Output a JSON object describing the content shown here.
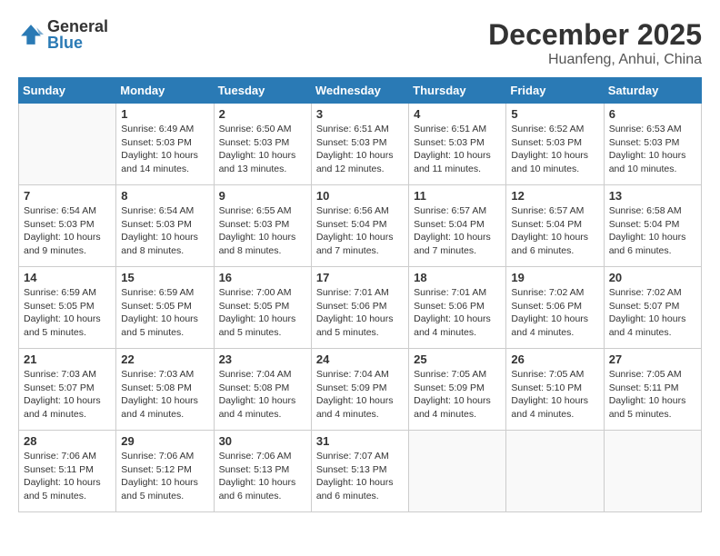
{
  "logo": {
    "general": "General",
    "blue": "Blue"
  },
  "title": "December 2025",
  "location": "Huanfeng, Anhui, China",
  "weekdays": [
    "Sunday",
    "Monday",
    "Tuesday",
    "Wednesday",
    "Thursday",
    "Friday",
    "Saturday"
  ],
  "weeks": [
    [
      {
        "day": "",
        "info": ""
      },
      {
        "day": "1",
        "info": "Sunrise: 6:49 AM\nSunset: 5:03 PM\nDaylight: 10 hours\nand 14 minutes."
      },
      {
        "day": "2",
        "info": "Sunrise: 6:50 AM\nSunset: 5:03 PM\nDaylight: 10 hours\nand 13 minutes."
      },
      {
        "day": "3",
        "info": "Sunrise: 6:51 AM\nSunset: 5:03 PM\nDaylight: 10 hours\nand 12 minutes."
      },
      {
        "day": "4",
        "info": "Sunrise: 6:51 AM\nSunset: 5:03 PM\nDaylight: 10 hours\nand 11 minutes."
      },
      {
        "day": "5",
        "info": "Sunrise: 6:52 AM\nSunset: 5:03 PM\nDaylight: 10 hours\nand 10 minutes."
      },
      {
        "day": "6",
        "info": "Sunrise: 6:53 AM\nSunset: 5:03 PM\nDaylight: 10 hours\nand 10 minutes."
      }
    ],
    [
      {
        "day": "7",
        "info": "Sunrise: 6:54 AM\nSunset: 5:03 PM\nDaylight: 10 hours\nand 9 minutes."
      },
      {
        "day": "8",
        "info": "Sunrise: 6:54 AM\nSunset: 5:03 PM\nDaylight: 10 hours\nand 8 minutes."
      },
      {
        "day": "9",
        "info": "Sunrise: 6:55 AM\nSunset: 5:03 PM\nDaylight: 10 hours\nand 8 minutes."
      },
      {
        "day": "10",
        "info": "Sunrise: 6:56 AM\nSunset: 5:04 PM\nDaylight: 10 hours\nand 7 minutes."
      },
      {
        "day": "11",
        "info": "Sunrise: 6:57 AM\nSunset: 5:04 PM\nDaylight: 10 hours\nand 7 minutes."
      },
      {
        "day": "12",
        "info": "Sunrise: 6:57 AM\nSunset: 5:04 PM\nDaylight: 10 hours\nand 6 minutes."
      },
      {
        "day": "13",
        "info": "Sunrise: 6:58 AM\nSunset: 5:04 PM\nDaylight: 10 hours\nand 6 minutes."
      }
    ],
    [
      {
        "day": "14",
        "info": "Sunrise: 6:59 AM\nSunset: 5:05 PM\nDaylight: 10 hours\nand 5 minutes."
      },
      {
        "day": "15",
        "info": "Sunrise: 6:59 AM\nSunset: 5:05 PM\nDaylight: 10 hours\nand 5 minutes."
      },
      {
        "day": "16",
        "info": "Sunrise: 7:00 AM\nSunset: 5:05 PM\nDaylight: 10 hours\nand 5 minutes."
      },
      {
        "day": "17",
        "info": "Sunrise: 7:01 AM\nSunset: 5:06 PM\nDaylight: 10 hours\nand 5 minutes."
      },
      {
        "day": "18",
        "info": "Sunrise: 7:01 AM\nSunset: 5:06 PM\nDaylight: 10 hours\nand 4 minutes."
      },
      {
        "day": "19",
        "info": "Sunrise: 7:02 AM\nSunset: 5:06 PM\nDaylight: 10 hours\nand 4 minutes."
      },
      {
        "day": "20",
        "info": "Sunrise: 7:02 AM\nSunset: 5:07 PM\nDaylight: 10 hours\nand 4 minutes."
      }
    ],
    [
      {
        "day": "21",
        "info": "Sunrise: 7:03 AM\nSunset: 5:07 PM\nDaylight: 10 hours\nand 4 minutes."
      },
      {
        "day": "22",
        "info": "Sunrise: 7:03 AM\nSunset: 5:08 PM\nDaylight: 10 hours\nand 4 minutes."
      },
      {
        "day": "23",
        "info": "Sunrise: 7:04 AM\nSunset: 5:08 PM\nDaylight: 10 hours\nand 4 minutes."
      },
      {
        "day": "24",
        "info": "Sunrise: 7:04 AM\nSunset: 5:09 PM\nDaylight: 10 hours\nand 4 minutes."
      },
      {
        "day": "25",
        "info": "Sunrise: 7:05 AM\nSunset: 5:09 PM\nDaylight: 10 hours\nand 4 minutes."
      },
      {
        "day": "26",
        "info": "Sunrise: 7:05 AM\nSunset: 5:10 PM\nDaylight: 10 hours\nand 4 minutes."
      },
      {
        "day": "27",
        "info": "Sunrise: 7:05 AM\nSunset: 5:11 PM\nDaylight: 10 hours\nand 5 minutes."
      }
    ],
    [
      {
        "day": "28",
        "info": "Sunrise: 7:06 AM\nSunset: 5:11 PM\nDaylight: 10 hours\nand 5 minutes."
      },
      {
        "day": "29",
        "info": "Sunrise: 7:06 AM\nSunset: 5:12 PM\nDaylight: 10 hours\nand 5 minutes."
      },
      {
        "day": "30",
        "info": "Sunrise: 7:06 AM\nSunset: 5:13 PM\nDaylight: 10 hours\nand 6 minutes."
      },
      {
        "day": "31",
        "info": "Sunrise: 7:07 AM\nSunset: 5:13 PM\nDaylight: 10 hours\nand 6 minutes."
      },
      {
        "day": "",
        "info": ""
      },
      {
        "day": "",
        "info": ""
      },
      {
        "day": "",
        "info": ""
      }
    ]
  ]
}
